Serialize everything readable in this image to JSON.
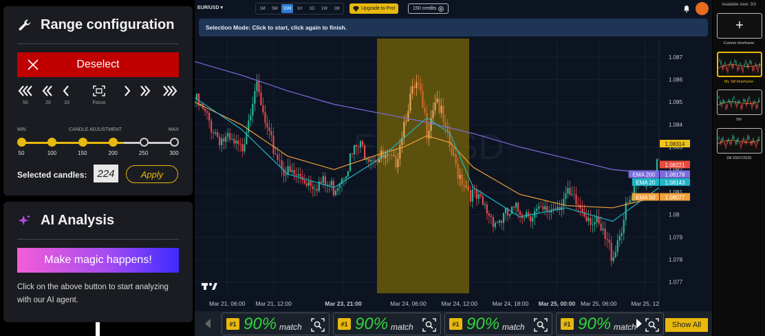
{
  "range_panel": {
    "title": "Range configuration",
    "deselect_label": "Deselect",
    "nav": [
      {
        "icon": "triple-chevron-left-icon",
        "label": "50"
      },
      {
        "icon": "double-chevron-left-icon",
        "label": "20"
      },
      {
        "icon": "chevron-left-icon",
        "label": "10"
      },
      {
        "icon": "focus-icon",
        "label": "Focus"
      },
      {
        "icon": "chevron-right-icon",
        "label": ""
      },
      {
        "icon": "double-chevron-right-icon",
        "label": ""
      },
      {
        "icon": "triple-chevron-right-icon",
        "label": ""
      }
    ],
    "slider": {
      "min_label": "MIN",
      "middle_label": "CANDLE  ADJUSTMENT",
      "max_label": "MAX",
      "ticks": [
        "50",
        "100",
        "150",
        "200",
        "250",
        "300"
      ],
      "selected_fraction": 0.67
    },
    "selected_label": "Selected candles:",
    "selected_value": "224",
    "apply_label": "Apply"
  },
  "ai_panel": {
    "title": "AI Analysis",
    "button_label": "Make magic happens!",
    "description": "Click on the above button to start analyzing with our AI agent."
  },
  "chart_toolbar": {
    "pair": "EUR/USD",
    "timeframes": [
      "1M",
      "5M",
      "15M",
      "1H",
      "1D",
      "1W",
      "1M"
    ],
    "active_timeframe": "15M",
    "upgrade_label": "Upgrade to Pro!",
    "credits_label": "150 credits"
  },
  "banner_text": "Selection Mode: Click to start, click again to finish.",
  "chart_data": {
    "type": "candlestick",
    "watermark": "EURUSD",
    "x_ticks": [
      "Mar 21, 06:00",
      "Mar 21, 12:00",
      "Mar 23, 21:00",
      "Mar 24, 06:00",
      "Mar 24, 12:00",
      "Mar 24, 18:00",
      "Mar 25, 00:00",
      "Mar 25, 06:00",
      "Mar 25, 12"
    ],
    "bold_x_ticks": [
      "Mar 23, 21:00",
      "Mar 25, 00:00"
    ],
    "y_ticks": [
      1.087,
      1.086,
      1.085,
      1.084,
      1.083,
      1.082,
      1.081,
      1.08,
      1.079,
      1.078,
      1.077
    ],
    "ylim": [
      1.0765,
      1.0877
    ],
    "price_tags": [
      {
        "label": "",
        "value": "1.08314",
        "color": "#f0c419"
      },
      {
        "label": "",
        "value": "1.08221",
        "color": "#e84b3c"
      },
      {
        "label": "EMA 200",
        "value": "1.08178",
        "color": "#7b6ce0"
      },
      {
        "label": "EMA 20",
        "value": "1.08143",
        "color": "#1fb5c8"
      },
      {
        "label": "EMA 50",
        "value": "1.08077",
        "color": "#f2a03a"
      }
    ],
    "selection_range": [
      "Mar 23, 21:00",
      "Mar 24, 12:00"
    ],
    "series": [
      {
        "name": "EMA 200",
        "color": "#7b6ce0",
        "x": [
          0,
          0.1,
          0.2,
          0.3,
          0.4,
          0.5,
          0.6,
          0.7,
          0.8,
          0.9,
          1.0
        ],
        "values": [
          1.0868,
          1.0862,
          1.0855,
          1.0849,
          1.0845,
          1.0841,
          1.0836,
          1.083,
          1.0825,
          1.082,
          1.0818
        ]
      },
      {
        "name": "EMA 50",
        "color": "#f2a03a",
        "x": [
          0,
          0.1,
          0.2,
          0.3,
          0.4,
          0.45,
          0.5,
          0.55,
          0.6,
          0.7,
          0.8,
          0.9,
          1.0
        ],
        "values": [
          1.085,
          1.084,
          1.0826,
          1.082,
          1.0827,
          1.083,
          1.0835,
          1.0832,
          1.0821,
          1.0809,
          1.0804,
          1.0803,
          1.0808
        ]
      },
      {
        "name": "EMA 20",
        "color": "#1fb5c8",
        "x": [
          0,
          0.1,
          0.2,
          0.3,
          0.4,
          0.45,
          0.5,
          0.55,
          0.6,
          0.7,
          0.8,
          0.9,
          1.0
        ],
        "values": [
          1.0852,
          1.0838,
          1.0818,
          1.0812,
          1.0825,
          1.0834,
          1.0843,
          1.0836,
          1.0812,
          1.0799,
          1.0803,
          1.0797,
          1.0812
        ]
      },
      {
        "name": "Price",
        "color": "#e46a1e",
        "x": [
          0,
          0.05,
          0.1,
          0.13,
          0.16,
          0.2,
          0.25,
          0.3,
          0.35,
          0.4,
          0.43,
          0.46,
          0.48,
          0.5,
          0.52,
          0.54,
          0.56,
          0.6,
          0.65,
          0.7,
          0.75,
          0.8,
          0.85,
          0.88,
          0.9,
          0.93,
          0.96,
          1.0
        ],
        "values": [
          1.0851,
          1.0835,
          1.0828,
          1.0858,
          1.0833,
          1.0818,
          1.0815,
          1.0812,
          1.083,
          1.0825,
          1.0822,
          1.085,
          1.0857,
          1.0838,
          1.0854,
          1.0836,
          1.0822,
          1.0808,
          1.0797,
          1.0802,
          1.08,
          1.0808,
          1.08,
          1.079,
          1.0782,
          1.0802,
          1.0815,
          1.0822
        ]
      }
    ]
  },
  "matches": [
    {
      "rank": "#1",
      "percent": "90%",
      "word": "match"
    },
    {
      "rank": "#1",
      "percent": "90%",
      "word": "match"
    },
    {
      "rank": "#1",
      "percent": "90%",
      "word": "match"
    },
    {
      "rank": "#1",
      "percent": "90%",
      "word": "match"
    }
  ],
  "show_all_label": "Show All",
  "rail": {
    "header": "Available view: 3/3",
    "cards": [
      {
        "caption": "Custom timeframe",
        "kind": "add",
        "glyph": "+"
      },
      {
        "caption": "My 1M timeframe",
        "kind": "active"
      },
      {
        "caption": "5M",
        "kind": "normal"
      },
      {
        "caption": "1M 20/07/2025",
        "kind": "normal"
      }
    ]
  },
  "colors": {
    "accent_yellow": "#e8b80e",
    "danger_red": "#c00000",
    "bull": "#2bb594",
    "bear": "#e8474d"
  }
}
